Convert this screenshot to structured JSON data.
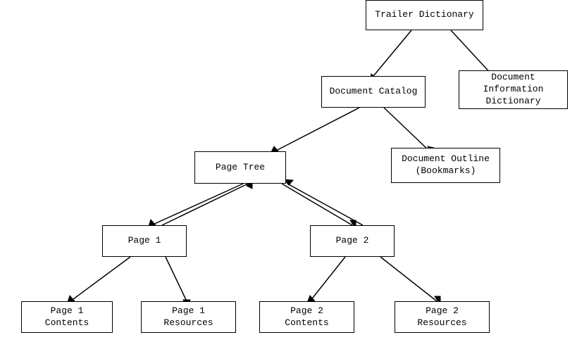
{
  "nodes": {
    "trailer": {
      "label": "Trailer Dictionary"
    },
    "catalog": {
      "label": "Document Catalog"
    },
    "info": {
      "label": "Document Information\nDictionary"
    },
    "page_tree": {
      "label": "Page Tree"
    },
    "outline": {
      "label": "Document Outline\n(Bookmarks)"
    },
    "page1": {
      "label": "Page 1"
    },
    "page2": {
      "label": "Page 2"
    },
    "page1contents": {
      "label": "Page 1 Contents"
    },
    "page1resources": {
      "label": "Page 1 Resources"
    },
    "page2contents": {
      "label": "Page 2 Contents"
    },
    "page2resources": {
      "label": "Page 2 Resources"
    }
  }
}
